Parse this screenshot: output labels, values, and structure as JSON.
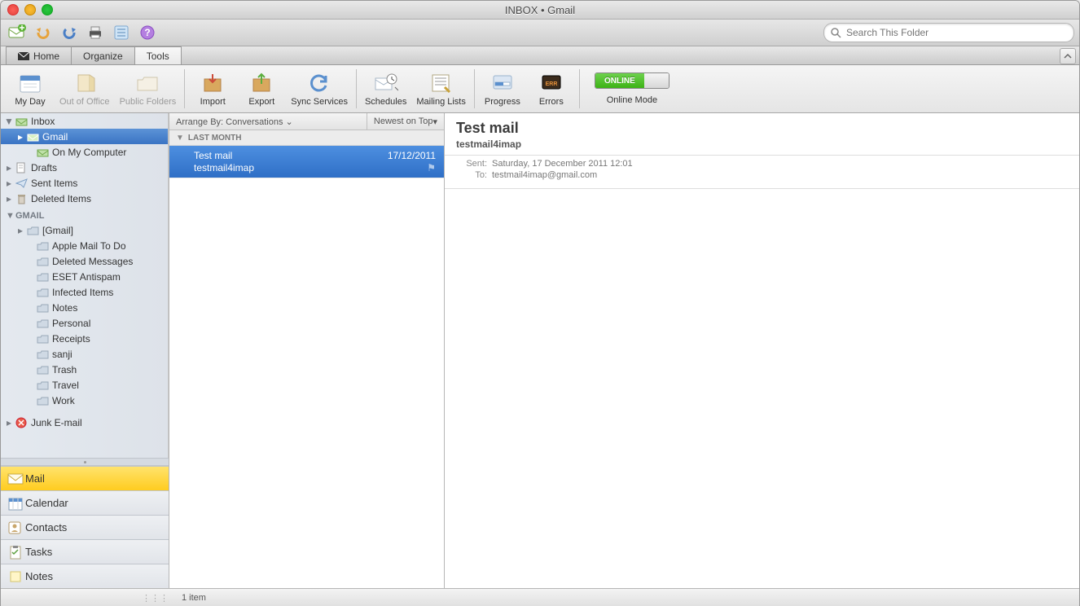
{
  "window": {
    "title": "INBOX • Gmail"
  },
  "toolbar1": {
    "search_placeholder": "Search This Folder"
  },
  "tabs": [
    {
      "label": "Home"
    },
    {
      "label": "Organize"
    },
    {
      "label": "Tools"
    }
  ],
  "ribbon": {
    "items": [
      {
        "label": "My Day"
      },
      {
        "label": "Out of Office"
      },
      {
        "label": "Public Folders"
      },
      {
        "label": "Import"
      },
      {
        "label": "Export"
      },
      {
        "label": "Sync Services"
      },
      {
        "label": "Schedules"
      },
      {
        "label": "Mailing Lists"
      },
      {
        "label": "Progress"
      },
      {
        "label": "Errors"
      }
    ],
    "online_label": "ONLINE",
    "online_mode": "Online Mode"
  },
  "sidebar": {
    "inbox": "Inbox",
    "gmail_acct": "Gmail",
    "on_my_computer": "On My Computer",
    "drafts": "Drafts",
    "sent": "Sent Items",
    "deleted": "Deleted Items",
    "gmail_section": "GMAIL",
    "gmail_folders": [
      "[Gmail]",
      "Apple Mail To Do",
      "Deleted Messages",
      "ESET Antispam",
      "Infected Items",
      "Notes",
      "Personal",
      "Receipts",
      "sanji",
      "Trash",
      "Travel",
      "Work"
    ],
    "junk": "Junk E-mail"
  },
  "nav": {
    "mail": "Mail",
    "calendar": "Calendar",
    "contacts": "Contacts",
    "tasks": "Tasks",
    "notes": "Notes"
  },
  "msglist": {
    "arrange_label": "Arrange By:",
    "arrange_value": "Conversations",
    "sort": "Newest on Top",
    "group": "LAST MONTH",
    "items": [
      {
        "subject": "Test mail",
        "from": "testmail4imap",
        "date": "17/12/2011"
      }
    ]
  },
  "preview": {
    "subject": "Test mail",
    "from": "testmail4imap",
    "sent_label": "Sent:",
    "sent_value": "Saturday, 17 December 2011 12:01",
    "to_label": "To:",
    "to_value": "testmail4imap@gmail.com"
  },
  "status": {
    "count": "1 item"
  }
}
